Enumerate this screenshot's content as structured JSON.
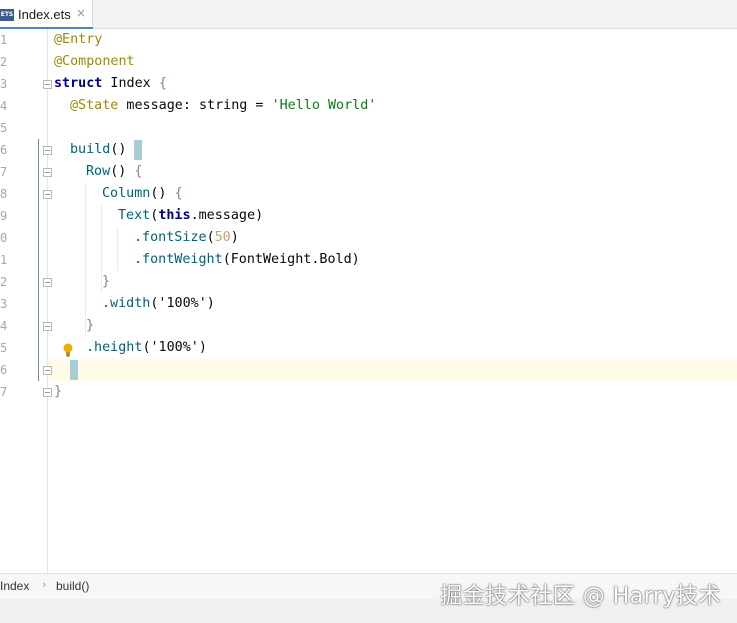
{
  "tab": {
    "icon_label": "ETS",
    "label": "Index.ets",
    "close_label": "×"
  },
  "line_numbers": [
    "1",
    "2",
    "3",
    "4",
    "5",
    "6",
    "7",
    "8",
    "9",
    "0",
    "1",
    "2",
    "3",
    "4",
    "5",
    "6",
    "7"
  ],
  "code": {
    "l1": "@Entry",
    "l2": "@Component",
    "l3_kw": "struct",
    "l3_name": " Index ",
    "l3_brace": "{",
    "l4_ann": "@State",
    "l4_rest": " message: string = ",
    "l4_str": "'Hello World'",
    "l6_fn": "build",
    "l6_paren": "()",
    "l7_fn": "Row",
    "l7_paren": "() ",
    "l7_brace": "{",
    "l8_fn": "Column",
    "l8_paren": "() ",
    "l8_brace": "{",
    "l9_fn": "Text",
    "l9_open": "(",
    "l9_this": "this",
    "l9_field": ".message",
    "l9_close": ")",
    "l10_method": ".fontSize",
    "l10_open": "(",
    "l10_num": "50",
    "l10_close": ")",
    "l11_method": ".fontWeight",
    "l11_arg": "(FontWeight.Bold)",
    "l12_brace": "}",
    "l13_method": ".width",
    "l13_arg": "('100%')",
    "l14_brace": "}",
    "l15_method": ".height",
    "l15_arg": "('100%')",
    "l17_brace": "}"
  },
  "breadcrumb": {
    "items": [
      "Index",
      "build()"
    ],
    "separator": "›"
  },
  "watermark": "掘金技术社区 @ Harry技术",
  "colors": {
    "annotation": "#9e880d",
    "keyword": "#0033b3",
    "string": "#067d17",
    "number": "#c9a26d",
    "caret_line": "#fffbe8"
  }
}
